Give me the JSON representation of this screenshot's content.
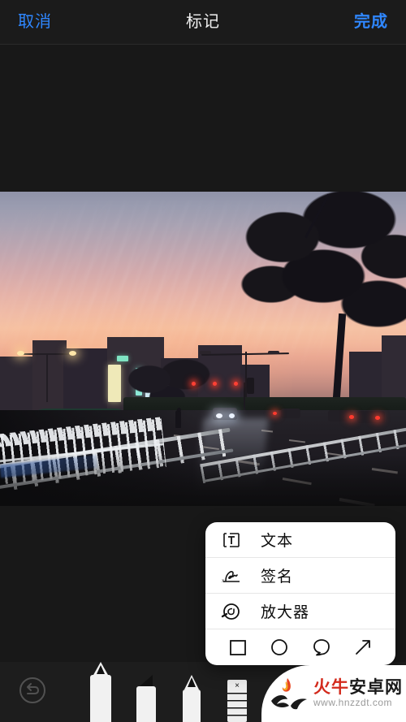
{
  "navbar": {
    "cancel_label": "取消",
    "title": "标记",
    "done_label": "完成"
  },
  "popup_menu": {
    "items": [
      {
        "label": "文本",
        "icon": "text-box-icon"
      },
      {
        "label": "签名",
        "icon": "signature-icon"
      },
      {
        "label": "放大器",
        "icon": "magnifier-icon"
      }
    ],
    "shapes": [
      {
        "name": "square-shape-icon"
      },
      {
        "name": "circle-shape-icon"
      },
      {
        "name": "speech-bubble-shape-icon"
      },
      {
        "name": "arrow-shape-icon"
      }
    ]
  },
  "toolbar": {
    "undo": "undo-icon",
    "tools": [
      {
        "name": "pen-tool",
        "selected": true
      },
      {
        "name": "marker-tool",
        "selected": false
      },
      {
        "name": "pencil-tool",
        "selected": false
      },
      {
        "name": "eraser-tool",
        "selected": false
      },
      {
        "name": "lasso-tool",
        "selected": false
      },
      {
        "name": "color-picker",
        "selected": false
      }
    ],
    "eraser_glyph": "×",
    "current_color": "#0a0a0a"
  },
  "watermark": {
    "title_part1": "火牛",
    "title_part2": "安卓网",
    "url": "www.hnzzdt.com"
  },
  "colors": {
    "accent_blue": "#2f87ff",
    "chrome_dark": "#181818",
    "toolbar_dark": "#1d1d1d",
    "popup_white": "#ffffff",
    "title_white": "#f2f2f2"
  }
}
